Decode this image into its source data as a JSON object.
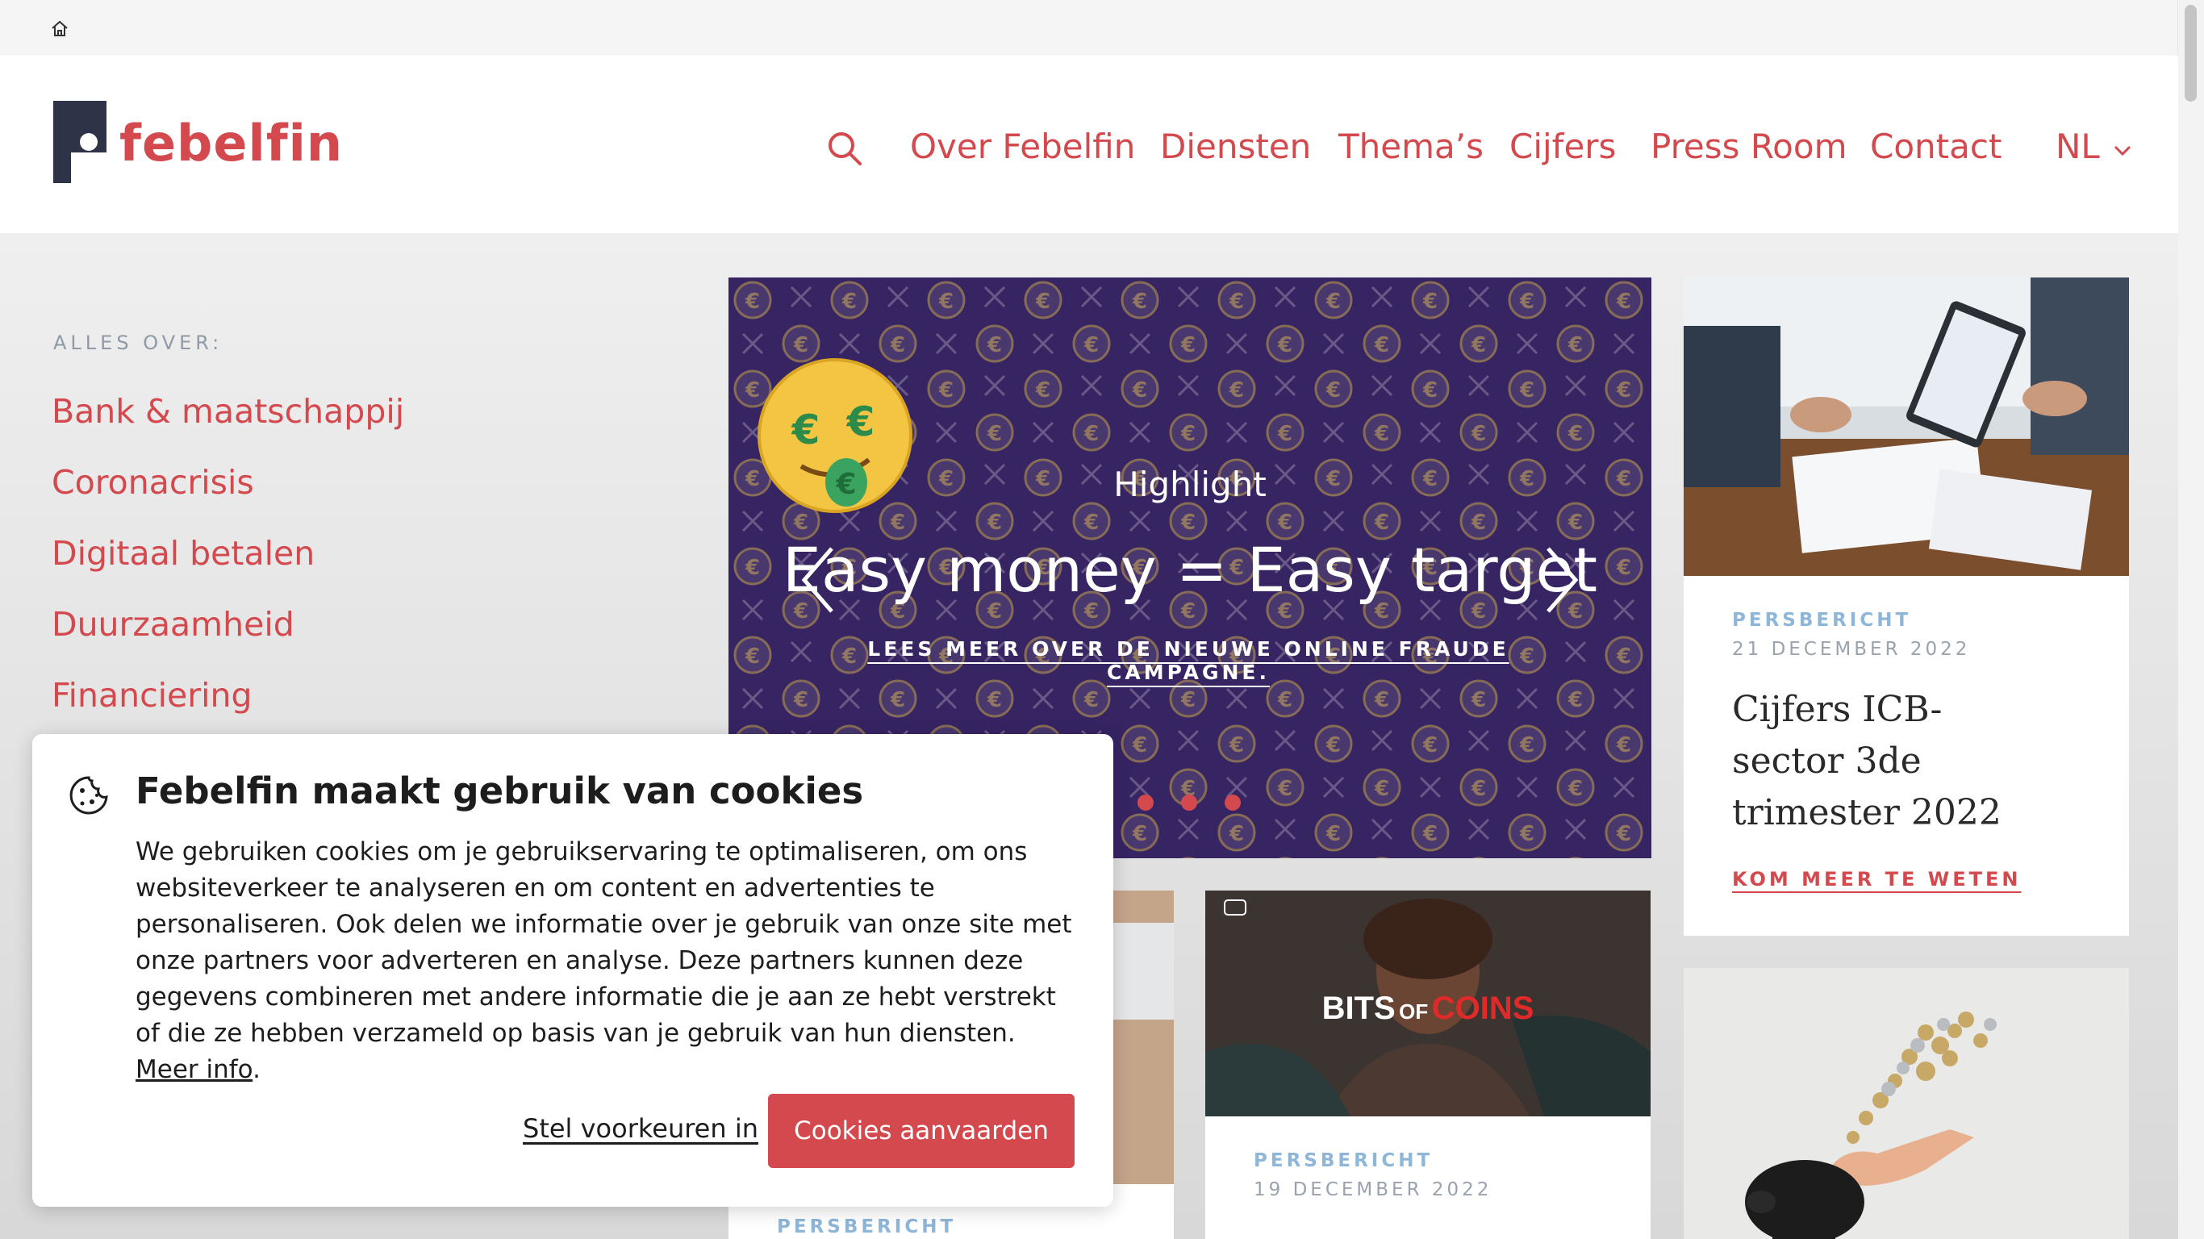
{
  "header": {
    "logo_text": "febelfin",
    "nav": [
      {
        "label": "Over Febelfin"
      },
      {
        "label": "Diensten"
      },
      {
        "label": "Thema’s"
      },
      {
        "label": "Cijfers"
      },
      {
        "label": "Press Room"
      },
      {
        "label": "Contact"
      }
    ],
    "language": "NL"
  },
  "sidebar": {
    "title": "ALLES OVER:",
    "items": [
      {
        "label": "Bank & maatschappij"
      },
      {
        "label": "Coronacrisis"
      },
      {
        "label": "Digitaal betalen"
      },
      {
        "label": "Duurzaamheid"
      },
      {
        "label": "Financiering"
      }
    ]
  },
  "hero": {
    "kicker": "Highlight",
    "title": "Easy money = Easy target",
    "link": "LEES MEER OVER DE NIEUWE ONLINE FRAUDE CAMPAGNE.",
    "slides_visible": 3
  },
  "cards": [
    {
      "badge": "PERSBERICHT",
      "date": "21 DECEMBER 2022",
      "title_lines": [
        "Cijfers ICB-",
        "sector 3de",
        "trimester 2022"
      ],
      "link": "KOM MEER TE WETEN"
    },
    {
      "badge": "PERSBERICHT",
      "date": "19 DECEMBER 2022",
      "image_text_1": "BITS",
      "image_text_2": "OF",
      "image_text_3": "COINS"
    },
    {
      "badge": "PERSBERICHT"
    }
  ],
  "cookie": {
    "title": "Febelfin maakt gebruik van cookies",
    "text": "We gebruiken cookies om je gebruikservaring te optimaliseren, om ons websiteverkeer te analyseren en om content en advertenties te personaliseren. Ook delen we informatie over je gebruik van onze site met onze partners voor adverteren en analyse. Deze partners kunnen deze gegevens combineren met andere informatie die je aan ze hebt verstrekt of die ze hebben verzameld op basis van je gebruik van hun diensten.",
    "more_info": "Meer info",
    "period": ".",
    "preferences": "Stel voorkeuren in",
    "accept": "Cookies aanvaarden"
  },
  "colors": {
    "brand": "#d4494d",
    "hero_bg": "#3e2b6d",
    "badge": "#8eb6d9"
  }
}
